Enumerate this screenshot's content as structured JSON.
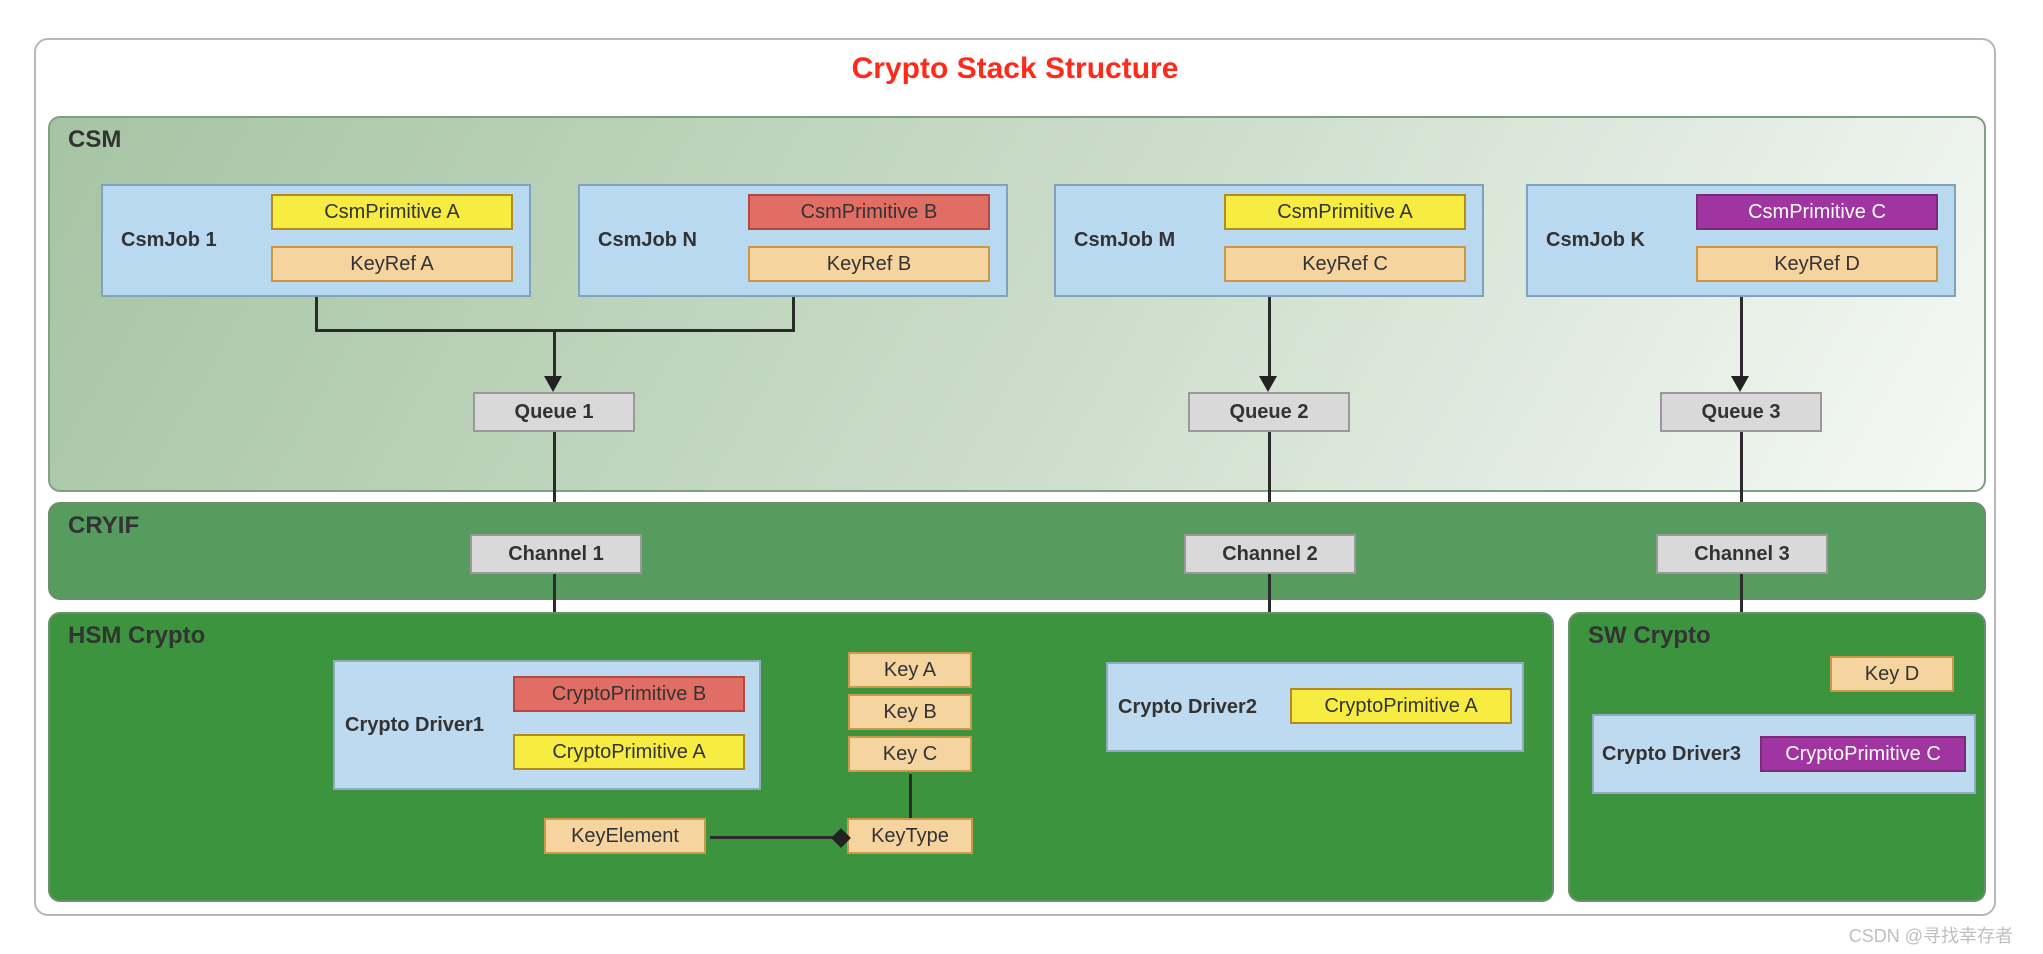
{
  "title": "Crypto Stack Structure",
  "layers": {
    "csm": "CSM",
    "cryif": "CRYIF",
    "hsm": "HSM Crypto",
    "sw": "SW Crypto"
  },
  "jobs": {
    "j1": {
      "label": "CsmJob 1",
      "primitive": "CsmPrimitive  A",
      "key": "KeyRef A"
    },
    "jN": {
      "label": "CsmJob N",
      "primitive": "CsmPrimitive B",
      "key": "KeyRef B"
    },
    "jM": {
      "label": "CsmJob M",
      "primitive": "CsmPrimitive A",
      "key": "KeyRef C"
    },
    "jK": {
      "label": "CsmJob K",
      "primitive": "CsmPrimitive C",
      "key": "KeyRef D"
    }
  },
  "queues": {
    "q1": "Queue 1",
    "q2": "Queue 2",
    "q3": "Queue 3"
  },
  "channels": {
    "c1": "Channel 1",
    "c2": "Channel 2",
    "c3": "Channel 3"
  },
  "drivers": {
    "d1": {
      "label": "Crypto Driver1",
      "pB": "CryptoPrimitive B",
      "pA": "CryptoPrimitive A"
    },
    "d2": {
      "label": "Crypto Driver2",
      "pA": "CryptoPrimitive A"
    },
    "d3": {
      "label": "Crypto Driver3",
      "pC": "CryptoPrimitive C"
    }
  },
  "keys": {
    "kA": "Key A",
    "kB": "Key B",
    "kC": "Key C",
    "kD": "Key D"
  },
  "keyElement": "KeyElement",
  "keyType": "KeyType",
  "watermark": "CSDN @寻找幸存者"
}
